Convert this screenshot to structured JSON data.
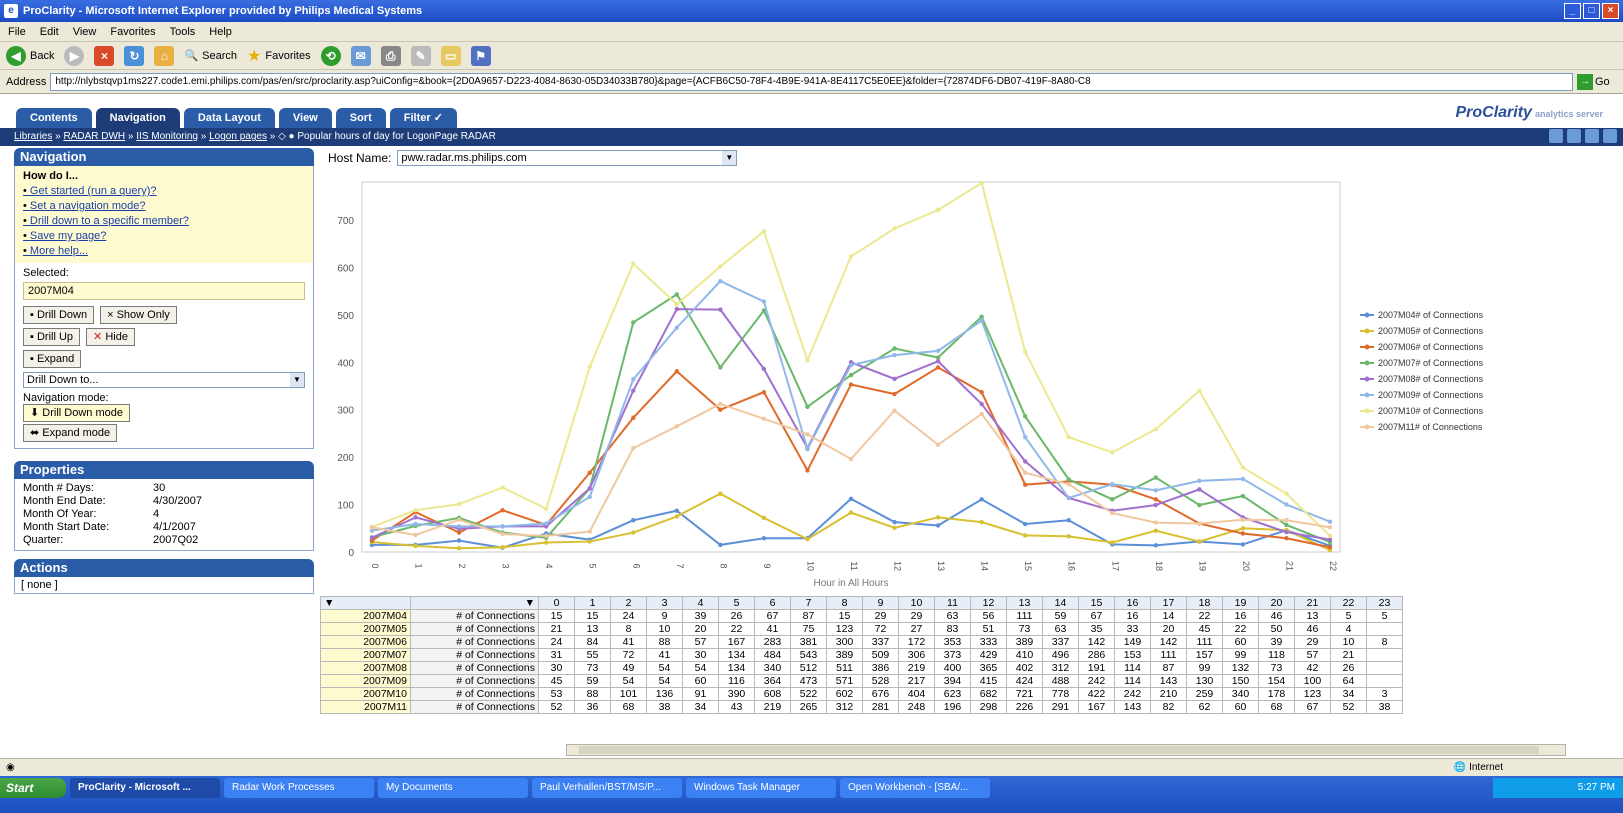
{
  "window": {
    "title": "ProClarity - Microsoft Internet Explorer provided by Philips Medical Systems"
  },
  "menu": [
    "File",
    "Edit",
    "View",
    "Favorites",
    "Tools",
    "Help"
  ],
  "toolbar": {
    "back": "Back",
    "search": "Search",
    "favorites": "Favorites"
  },
  "address": {
    "label": "Address",
    "url": "http://nlybstqvp1ms227.code1.emi.philips.com/pas/en/src/proclarity.asp?uiConfig=&book={2D0A9657-D223-4084-8630-05D34033B780}&page={ACFB6C50-78F4-4B9E-941A-8E4117C5E0EE}&folder={72874DF6-DB07-419F-8A80-C8",
    "go": "Go"
  },
  "app": {
    "tabs": [
      "Contents",
      "Navigation",
      "Data Layout",
      "View",
      "Sort",
      "Filter ✓"
    ],
    "brand": "ProClarity",
    "brand_sub": "analytics server"
  },
  "breadcrumb": {
    "items": [
      "Libraries",
      "RADAR DWH",
      "IIS Monitoring",
      "Logon pages"
    ],
    "current": "Popular hours of day for LogonPage RADAR"
  },
  "navigation": {
    "title": "Navigation",
    "howdo": "How do I...",
    "links": [
      "Get started (run a query)?",
      "Set a navigation mode?",
      "Drill down to a specific member?",
      "Save my page?",
      "More help..."
    ],
    "selected_label": "Selected:",
    "selected_value": "2007M04",
    "btn_drilldown": "Drill Down",
    "btn_showonly": "Show Only",
    "btn_drillup": "Drill Up",
    "btn_hide": "Hide",
    "btn_expand": "Expand",
    "drill_select": "Drill Down to...",
    "mode_label": "Navigation mode:",
    "mode_drill": "Drill Down mode",
    "mode_expand": "Expand mode"
  },
  "properties": {
    "title": "Properties",
    "rows": [
      {
        "k": "Month # Days:",
        "v": "30"
      },
      {
        "k": "Month End Date:",
        "v": "4/30/2007"
      },
      {
        "k": "Month Of Year:",
        "v": "4"
      },
      {
        "k": "Month Start Date:",
        "v": "4/1/2007"
      },
      {
        "k": "Quarter:",
        "v": "2007Q02"
      }
    ]
  },
  "actions": {
    "title": "Actions",
    "value": "[ none ]"
  },
  "host": {
    "label": "Host Name:",
    "value": "pww.radar.ms.philips.com"
  },
  "chart_data": {
    "type": "line",
    "x": [
      0,
      1,
      2,
      3,
      4,
      5,
      6,
      7,
      8,
      9,
      10,
      11,
      12,
      13,
      14,
      15,
      16,
      17,
      18,
      19,
      20,
      21,
      22
    ],
    "xlabel": "Hour in All Hours",
    "ylabel": "",
    "ylim": [
      0,
      780
    ],
    "yticks": [
      0,
      100,
      200,
      300,
      400,
      500,
      600,
      700
    ],
    "grid": false,
    "legend_position": "right",
    "series": [
      {
        "name": "2007M04# of Connections",
        "color": "#5b8fd8",
        "values": [
          15,
          15,
          24,
          9,
          39,
          26,
          67,
          87,
          15,
          29,
          29,
          112,
          63,
          56,
          111,
          59,
          67,
          16,
          14,
          22,
          16,
          46,
          13
        ]
      },
      {
        "name": "2007M05# of Connections",
        "color": "#d8c030",
        "values": [
          21,
          13,
          8,
          10,
          20,
          22,
          41,
          75,
          123,
          72,
          27,
          83,
          51,
          73,
          63,
          35,
          33,
          20,
          45,
          22,
          50,
          46,
          4
        ]
      },
      {
        "name": "2007M06# of Connections",
        "color": "#e06a2a",
        "values": [
          24,
          84,
          41,
          88,
          57,
          167,
          283,
          381,
          300,
          337,
          172,
          353,
          333,
          389,
          337,
          142,
          149,
          142,
          111,
          60,
          39,
          29,
          10
        ]
      },
      {
        "name": "2007M07# of Connections",
        "color": "#6ab86a",
        "values": [
          31,
          55,
          72,
          41,
          30,
          134,
          484,
          543,
          389,
          509,
          306,
          373,
          429,
          410,
          496,
          286,
          153,
          111,
          157,
          99,
          118,
          57,
          21
        ]
      },
      {
        "name": "2007M08# of Connections",
        "color": "#a070d0",
        "values": [
          30,
          73,
          49,
          54,
          54,
          134,
          340,
          512,
          511,
          386,
          219,
          400,
          365,
          402,
          312,
          191,
          114,
          87,
          99,
          132,
          73,
          42,
          26
        ]
      },
      {
        "name": "2007M09# of Connections",
        "color": "#90b8e8",
        "values": [
          45,
          59,
          54,
          54,
          60,
          116,
          364,
          473,
          571,
          528,
          217,
          394,
          415,
          424,
          488,
          242,
          114,
          143,
          130,
          150,
          154,
          100,
          64
        ]
      },
      {
        "name": "2007M10# of Connections",
        "color": "#ece890",
        "values": [
          53,
          88,
          101,
          136,
          91,
          390,
          608,
          522,
          602,
          676,
          404,
          623,
          682,
          721,
          778,
          422,
          242,
          210,
          259,
          340,
          178,
          123,
          34
        ]
      },
      {
        "name": "2007M11# of Connections",
        "color": "#f0c8a0",
        "values": [
          52,
          36,
          68,
          38,
          34,
          43,
          219,
          265,
          312,
          281,
          248,
          196,
          298,
          226,
          291,
          167,
          143,
          82,
          62,
          60,
          68,
          67,
          52
        ]
      }
    ]
  },
  "table": {
    "measure": "# of Connections",
    "hours": [
      "0",
      "1",
      "2",
      "3",
      "4",
      "5",
      "6",
      "7",
      "8",
      "9",
      "10",
      "11",
      "12",
      "13",
      "14",
      "15",
      "16",
      "17",
      "18",
      "19",
      "20",
      "21",
      "22",
      "23"
    ],
    "rows": [
      {
        "member": "2007M04",
        "values": [
          "15",
          "15",
          "24",
          "9",
          "39",
          "26",
          "67",
          "87",
          "15",
          "29",
          "29",
          "63",
          "56",
          "111",
          "59",
          "67",
          "16",
          "14",
          "22",
          "16",
          "46",
          "13",
          "5",
          "5"
        ]
      },
      {
        "member": "2007M05",
        "values": [
          "21",
          "13",
          "8",
          "10",
          "20",
          "22",
          "41",
          "75",
          "123",
          "72",
          "27",
          "83",
          "51",
          "73",
          "63",
          "35",
          "33",
          "20",
          "45",
          "22",
          "50",
          "46",
          "4",
          ""
        ]
      },
      {
        "member": "2007M06",
        "values": [
          "24",
          "84",
          "41",
          "88",
          "57",
          "167",
          "283",
          "381",
          "300",
          "337",
          "172",
          "353",
          "333",
          "389",
          "337",
          "142",
          "149",
          "142",
          "111",
          "60",
          "39",
          "29",
          "10",
          "8"
        ]
      },
      {
        "member": "2007M07",
        "values": [
          "31",
          "55",
          "72",
          "41",
          "30",
          "134",
          "484",
          "543",
          "389",
          "509",
          "306",
          "373",
          "429",
          "410",
          "496",
          "286",
          "153",
          "111",
          "157",
          "99",
          "118",
          "57",
          "21",
          ""
        ]
      },
      {
        "member": "2007M08",
        "values": [
          "30",
          "73",
          "49",
          "54",
          "54",
          "134",
          "340",
          "512",
          "511",
          "386",
          "219",
          "400",
          "365",
          "402",
          "312",
          "191",
          "114",
          "87",
          "99",
          "132",
          "73",
          "42",
          "26",
          ""
        ]
      },
      {
        "member": "2007M09",
        "values": [
          "45",
          "59",
          "54",
          "54",
          "60",
          "116",
          "364",
          "473",
          "571",
          "528",
          "217",
          "394",
          "415",
          "424",
          "488",
          "242",
          "114",
          "143",
          "130",
          "150",
          "154",
          "100",
          "64",
          ""
        ]
      },
      {
        "member": "2007M10",
        "values": [
          "53",
          "88",
          "101",
          "136",
          "91",
          "390",
          "608",
          "522",
          "602",
          "676",
          "404",
          "623",
          "682",
          "721",
          "778",
          "422",
          "242",
          "210",
          "259",
          "340",
          "178",
          "123",
          "34",
          "3"
        ]
      },
      {
        "member": "2007M11",
        "values": [
          "52",
          "36",
          "68",
          "38",
          "34",
          "43",
          "219",
          "265",
          "312",
          "281",
          "248",
          "196",
          "298",
          "226",
          "291",
          "167",
          "143",
          "82",
          "62",
          "60",
          "68",
          "67",
          "52",
          "38"
        ]
      }
    ]
  },
  "status": {
    "zone": "Internet"
  },
  "taskbar": {
    "start": "Start",
    "tasks": [
      "ProClarity - Microsoft ...",
      "Radar Work Processes",
      "My Documents",
      "Paul Verhallen/BST/MS/P...",
      "Windows Task Manager",
      "Open Workbench - [SBA/..."
    ],
    "clock": "5:27 PM"
  }
}
